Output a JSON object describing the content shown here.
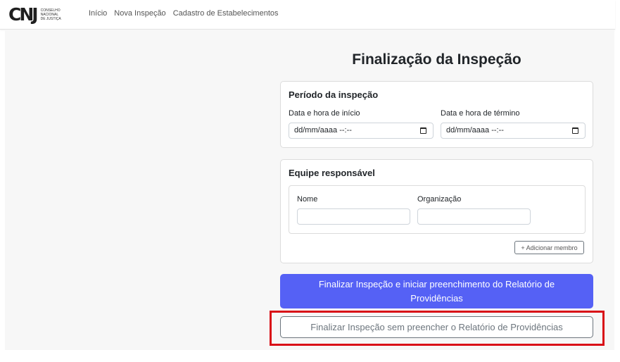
{
  "navbar": {
    "logo": {
      "mark": "CNJ",
      "lines": [
        "CONSELHO",
        "NACIONAL",
        "DE JUSTIÇA"
      ]
    },
    "links": [
      "Início",
      "Nova Inspeção",
      "Cadastro de Estabelecimentos"
    ]
  },
  "page": {
    "title": "Finalização da Inspeção"
  },
  "periodo": {
    "title": "Período da inspeção",
    "start_label": "Data e hora de início",
    "start_value": "dd/mm/aaaa --:--",
    "end_label": "Data e hora de término",
    "end_value": "dd/mm/aaaa --:--"
  },
  "equipe": {
    "title": "Equipe responsável",
    "name_label": "Nome",
    "org_label": "Organização",
    "add_label": "+ Adicionar membro"
  },
  "actions": {
    "primary_label": "Finalizar Inspeção e iniciar preenchimento do Relatório de Providências",
    "secondary_label": "Finalizar Inspeção sem preencher o Relatório de Providências"
  },
  "colors": {
    "primary": "#5561f5",
    "secondary": "#6c757d",
    "highlight": "#d90f17"
  }
}
